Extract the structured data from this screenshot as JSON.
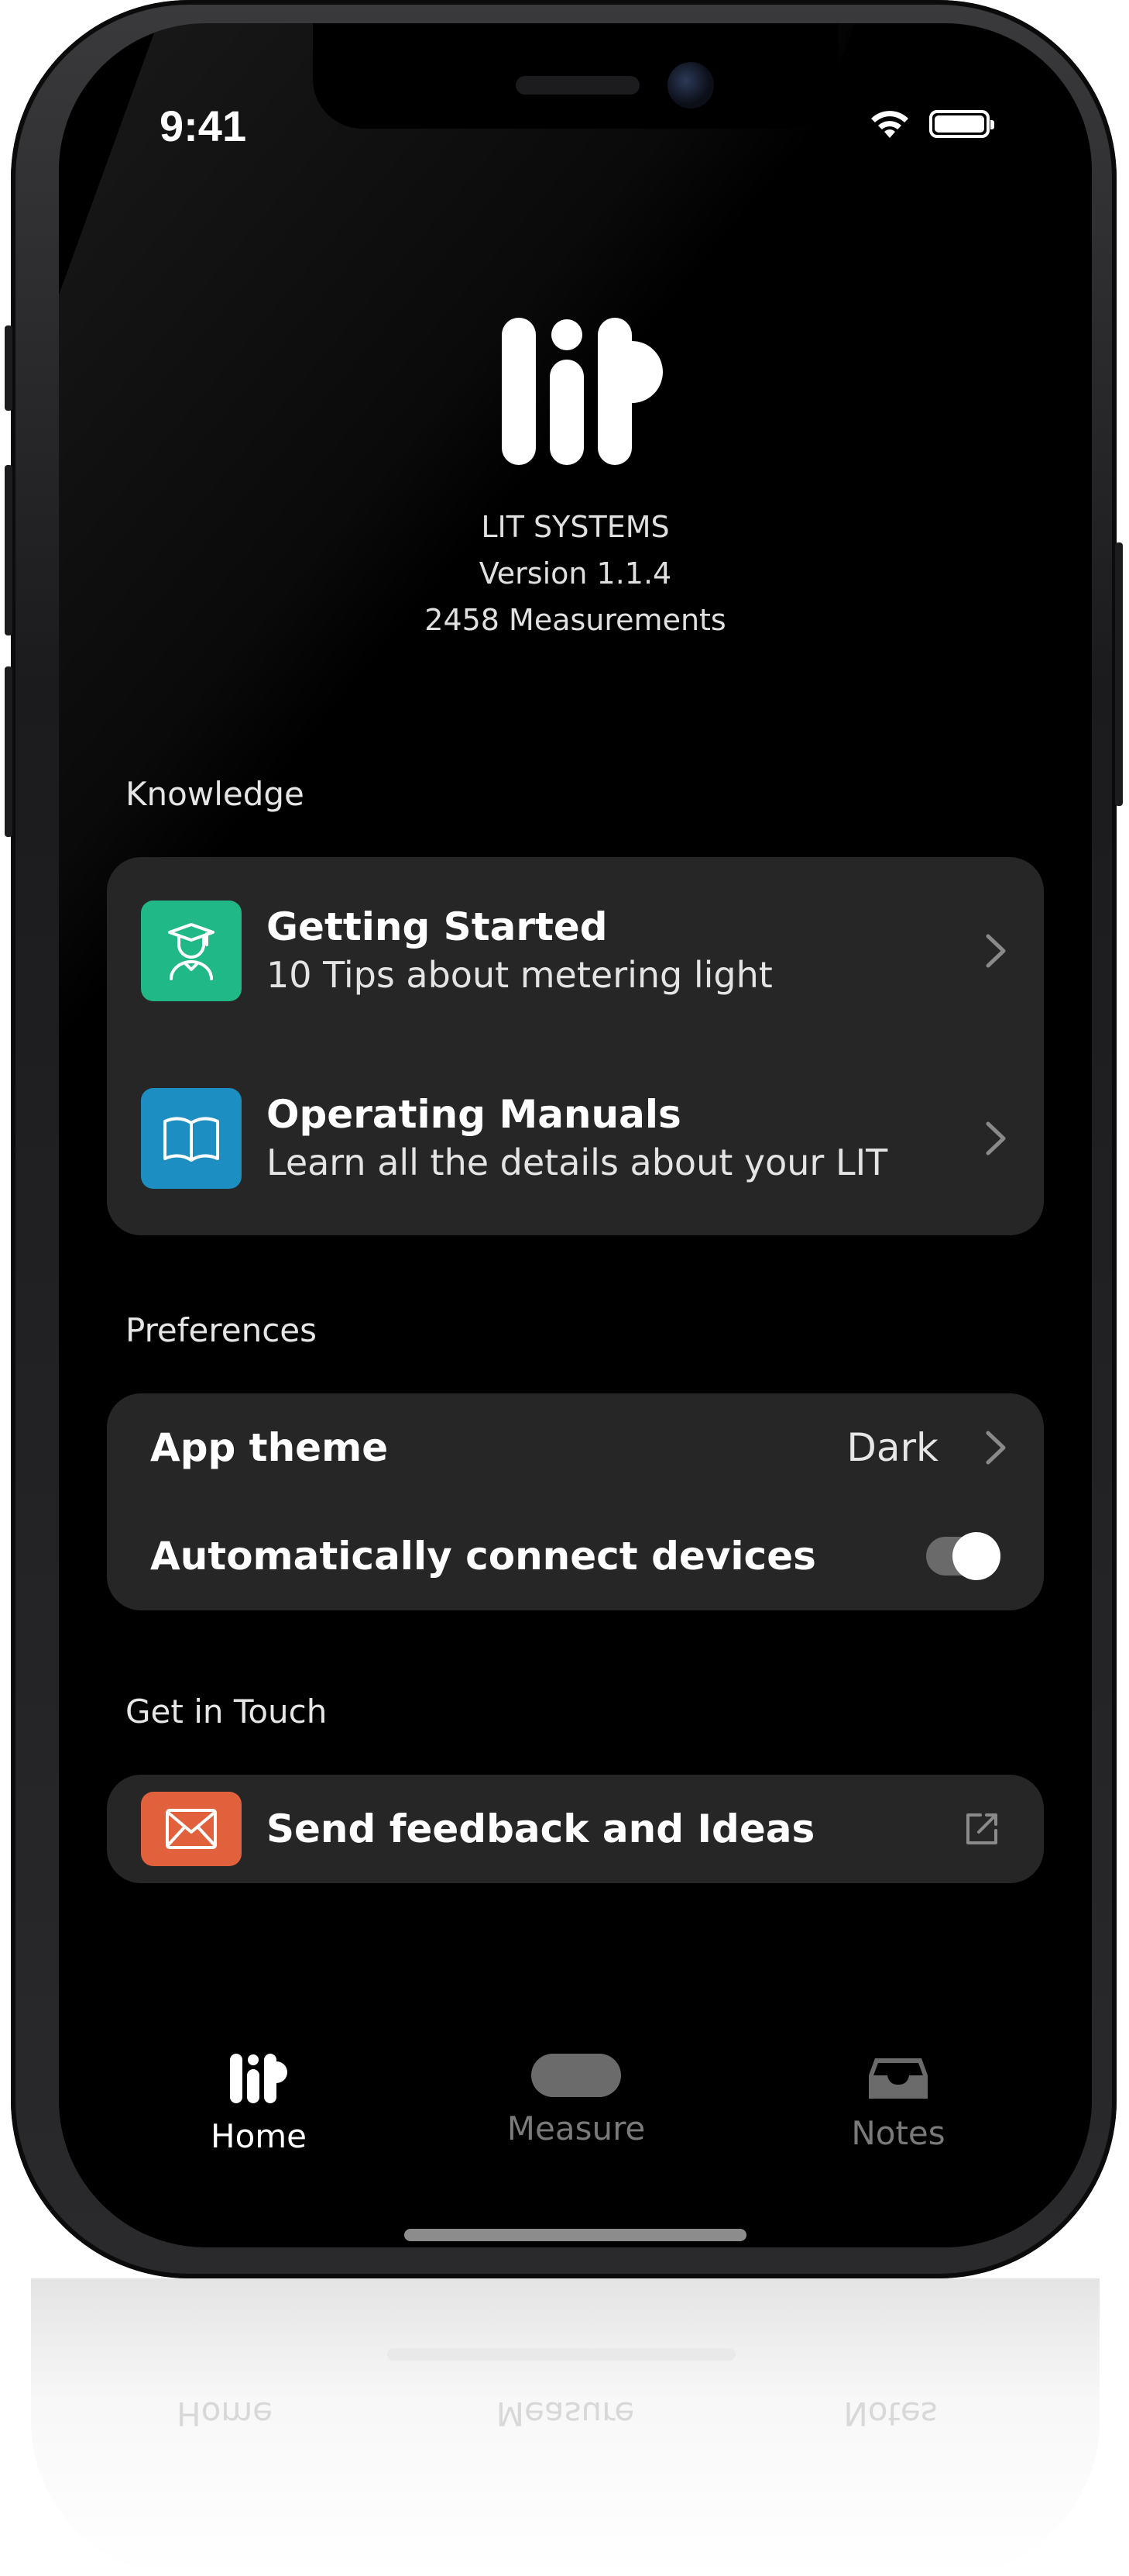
{
  "status_bar": {
    "time": "9:41"
  },
  "app": {
    "company": "LIT SYSTEMS",
    "version": "Version 1.1.4",
    "measurements": "2458 Measurements"
  },
  "knowledge": {
    "label": "Knowledge",
    "items": [
      {
        "title": "Getting Started",
        "subtitle": "10 Tips about metering light",
        "icon": "graduate-icon",
        "color": "#1fb886"
      },
      {
        "title": "Operating Manuals",
        "subtitle": "Learn all the details about your LIT",
        "icon": "book-icon",
        "color": "#1c8ec2"
      }
    ]
  },
  "preferences": {
    "label": "Preferences",
    "app_theme": {
      "title": "App theme",
      "value": "Dark"
    },
    "auto_connect": {
      "title": "Automatically connect devices",
      "enabled": true
    }
  },
  "contact": {
    "label": "Get in Touch",
    "feedback": {
      "title": "Send feedback and Ideas",
      "icon": "mail-icon",
      "color": "#e0613c"
    }
  },
  "tabs": [
    {
      "label": "Home",
      "icon": "lit-logo-icon",
      "active": true
    },
    {
      "label": "Measure",
      "icon": "pill-icon",
      "active": false
    },
    {
      "label": "Notes",
      "icon": "inbox-icon",
      "active": false
    }
  ],
  "reflection_labels": [
    "Home",
    "Measure",
    "Notes"
  ]
}
